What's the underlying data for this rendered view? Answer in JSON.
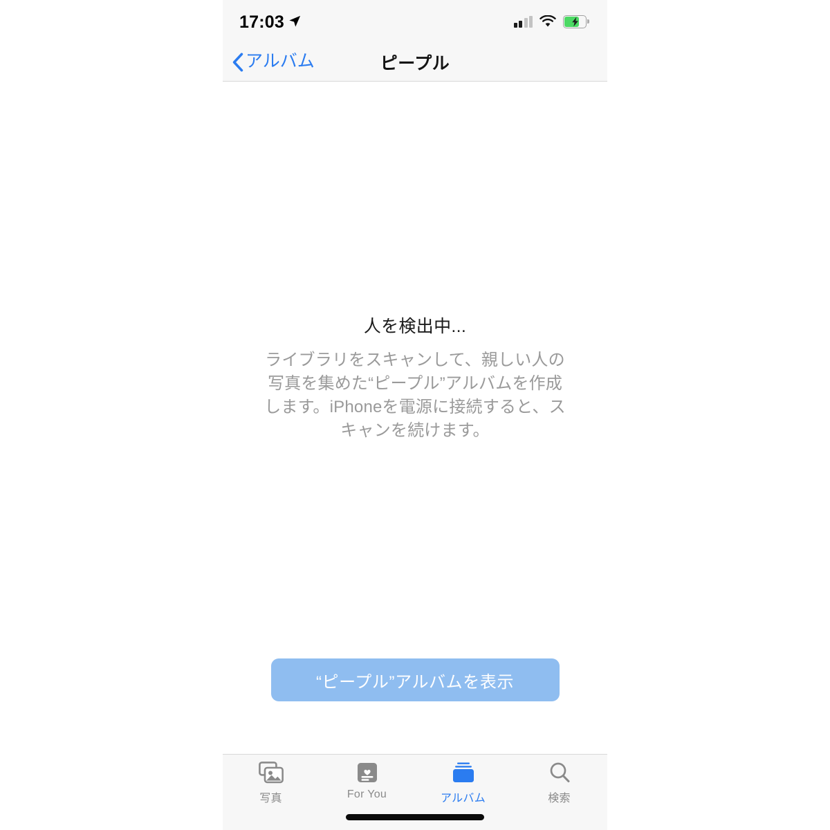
{
  "status_bar": {
    "time": "17:03",
    "location_icon": "location-arrow-icon",
    "signal_icon": "cellular-signal-icon",
    "signal_bars_filled": 2,
    "signal_bars_total": 4,
    "wifi_icon": "wifi-icon",
    "battery_icon": "battery-charging-icon",
    "battery_level_percent": 60,
    "battery_charging": true
  },
  "nav_bar": {
    "back_icon": "chevron-left-icon",
    "back_label": "アルバム",
    "title": "ピープル",
    "tint_color": "#2b7cf0"
  },
  "empty_state": {
    "title": "人を検出中...",
    "description": "ライブラリをスキャンして、親しい人の写真を集めた“ピープル”アルバムを作成します。iPhoneを電源に接続すると、スキャンを続けます。"
  },
  "cta": {
    "label": "“ピープル”アルバムを表示",
    "background_color": "#8fbdf0",
    "text_color": "#ffffff"
  },
  "tab_bar": {
    "active_color": "#2b7cf0",
    "inactive_color": "#8a8a8a",
    "items": [
      {
        "label": "写真",
        "icon": "photos-icon",
        "active": false
      },
      {
        "label": "For You",
        "icon": "foryou-heart-card-icon",
        "active": false
      },
      {
        "label": "アルバム",
        "icon": "albums-icon",
        "active": true
      },
      {
        "label": "検索",
        "icon": "search-magnifier-icon",
        "active": false
      }
    ]
  },
  "home_indicator": "home-indicator-bar"
}
